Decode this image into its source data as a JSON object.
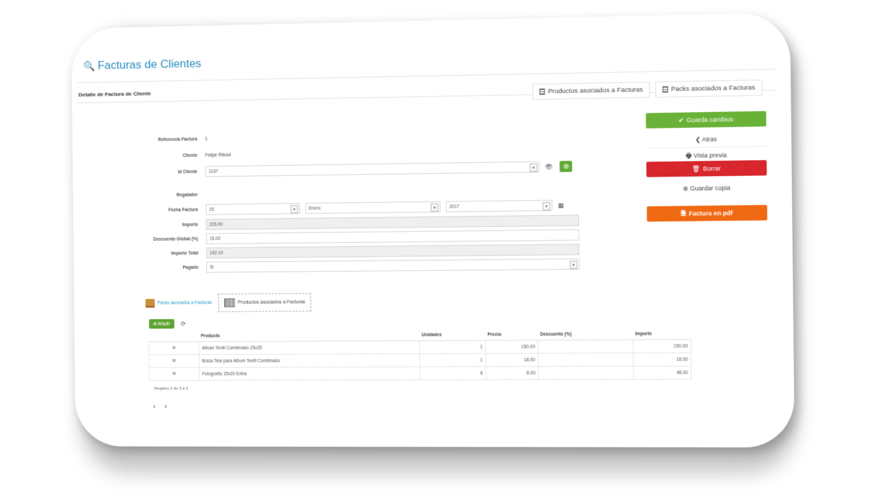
{
  "app": {
    "title": "Facturas de Clientes"
  },
  "detail": {
    "title": "Detalle de Factura de Cliente"
  },
  "top_tabs": [
    {
      "label": "Productos asociados a Facturas"
    },
    {
      "label": "Packs asociados a Facturas"
    }
  ],
  "form": {
    "referencia": {
      "label": "Referencia Factura",
      "value": "1"
    },
    "cliente": {
      "label": "Cliente",
      "value": "Felipe Riboul"
    },
    "id_cliente": {
      "label": "Id Cliente",
      "value": "1137"
    },
    "regalador": {
      "label": "Regalador",
      "value": ""
    },
    "fecha": {
      "label": "Fecha Factura",
      "day": "15",
      "month": "Enero",
      "year": "2017"
    },
    "importe": {
      "label": "Importe",
      "value": "226.00"
    },
    "descuento": {
      "label": "Descuento Global (%)",
      "value": "15.00"
    },
    "importe_total": {
      "label": "Importe Total",
      "value": "192.10"
    },
    "pagado": {
      "label": "Pagado",
      "value": "Si"
    }
  },
  "actions": {
    "save": "Guarda cambios",
    "back": "Atras",
    "preview": "Vista previa",
    "delete": "Borrar",
    "save_copy": "Guardar copia",
    "pdf": "Factura en pdf"
  },
  "lower_tabs": [
    {
      "label": "Packs asociados a Facturas"
    },
    {
      "label": "Productos asociados a Facturas"
    }
  ],
  "toolbar": {
    "add": "Añadir"
  },
  "table": {
    "headers": [
      "",
      "Producto",
      "Unidades",
      "Precio",
      "Descuento (%)",
      "Importe"
    ],
    "rows": [
      {
        "producto": "Album Textil Combinado 25x25",
        "unidades": "1",
        "precio": "150.00",
        "descuento": "",
        "importe": "150.00"
      },
      {
        "producto": "Bolsa Tela para Album Textil Combinado",
        "unidades": "1",
        "precio": "18.00",
        "descuento": "",
        "importe": "18.00"
      },
      {
        "producto": "Fotografía 15x20 Extra",
        "unidades": "6",
        "precio": "8.00",
        "descuento": "",
        "importe": "48.00"
      }
    ]
  },
  "footer": {
    "records": "Registro 1 de 3 a 3"
  },
  "colors": {
    "accent": "#2a8ec0",
    "green": "#69b237",
    "red": "#d7262c",
    "orange": "#f06a14"
  },
  "icons": [
    "search-icon",
    "check-icon",
    "chevron-left-icon",
    "printer-icon",
    "trash-icon",
    "plus-circle-icon",
    "file-icon",
    "eye-icon",
    "calendar-icon",
    "edit-icon",
    "refresh-icon",
    "box-icon",
    "barcode-icon"
  ]
}
